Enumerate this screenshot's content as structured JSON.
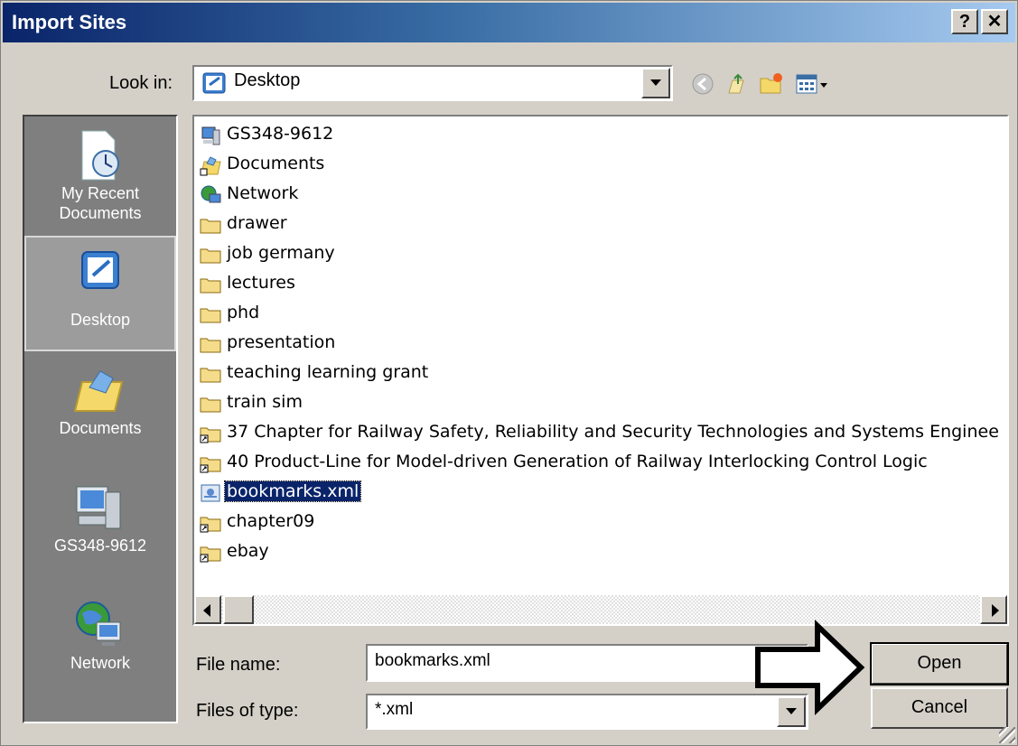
{
  "window": {
    "title": "Import Sites"
  },
  "titlebar_buttons": {
    "help": "?",
    "close": "✕"
  },
  "lookin": {
    "label": "Look in:",
    "value": "Desktop"
  },
  "places": [
    {
      "label": "My Recent Documents",
      "icon": "recent-documents-icon"
    },
    {
      "label": "Desktop",
      "icon": "desktop-icon",
      "selected": true
    },
    {
      "label": "Documents",
      "icon": "documents-icon"
    },
    {
      "label": "GS348-9612",
      "icon": "computer-icon"
    },
    {
      "label": "Network",
      "icon": "network-icon"
    }
  ],
  "files": [
    {
      "name": "GS348-9612",
      "icon": "computer-icon"
    },
    {
      "name": "Documents",
      "icon": "documents-icon"
    },
    {
      "name": "Network",
      "icon": "network-icon"
    },
    {
      "name": "drawer",
      "icon": "folder-icon"
    },
    {
      "name": "job germany",
      "icon": "folder-icon"
    },
    {
      "name": "lectures",
      "icon": "folder-icon"
    },
    {
      "name": "phd",
      "icon": "folder-icon"
    },
    {
      "name": "presentation",
      "icon": "folder-icon"
    },
    {
      "name": "teaching learning grant",
      "icon": "folder-icon"
    },
    {
      "name": "train sim",
      "icon": "folder-icon"
    },
    {
      "name": "37 Chapter for Railway Safety, Reliability and Security Technologies and Systems Enginee",
      "icon": "folder-shortcut-icon"
    },
    {
      "name": "40 Product-Line for Model-driven Generation of Railway Interlocking Control Logic",
      "icon": "folder-shortcut-icon"
    },
    {
      "name": "bookmarks.xml",
      "icon": "xml-file-icon",
      "selected": true
    },
    {
      "name": "chapter09",
      "icon": "folder-shortcut-icon"
    },
    {
      "name": "ebay",
      "icon": "folder-shortcut-icon"
    }
  ],
  "filename": {
    "label": "File name:",
    "value": "bookmarks.xml"
  },
  "filetype": {
    "label": "Files of type:",
    "value": "*.xml"
  },
  "buttons": {
    "open": "Open",
    "cancel": "Cancel"
  },
  "colors": {
    "title_start": "#0a246a",
    "title_end": "#a6caf0",
    "selection": "#0a246a",
    "face": "#d4d0c8"
  }
}
